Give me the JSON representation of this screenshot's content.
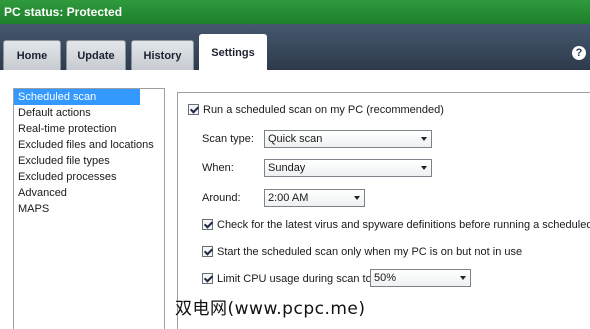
{
  "window": {
    "title": "PC status: Protected"
  },
  "tabs": [
    {
      "label": "Home"
    },
    {
      "label": "Update"
    },
    {
      "label": "History"
    },
    {
      "label": "Settings"
    }
  ],
  "help_icon": {
    "glyph": "?"
  },
  "sidebar": {
    "items": [
      {
        "label": "Scheduled scan"
      },
      {
        "label": "Default actions"
      },
      {
        "label": "Real-time protection"
      },
      {
        "label": "Excluded files and locations"
      },
      {
        "label": "Excluded file types"
      },
      {
        "label": "Excluded processes"
      },
      {
        "label": "Advanced"
      },
      {
        "label": "MAPS"
      }
    ]
  },
  "settings": {
    "run_scheduled": {
      "label": "Run a scheduled scan on my PC (recommended)",
      "checked": true
    },
    "scan_type": {
      "label": "Scan type:",
      "value": "Quick scan"
    },
    "when": {
      "label": "When:",
      "value": "Sunday"
    },
    "around": {
      "label": "Around:",
      "value": "2:00 AM"
    },
    "check_definitions": {
      "label": "Check for the latest virus and spyware definitions before running a scheduled scan",
      "checked": true
    },
    "only_idle": {
      "label": "Start the scheduled scan only when my PC is on but not in use",
      "checked": true
    },
    "limit_cpu": {
      "label": "Limit CPU usage during scan to:",
      "checked": true,
      "value": "50%"
    }
  },
  "watermark": {
    "text": "双电网(www.pcpc.me)"
  }
}
